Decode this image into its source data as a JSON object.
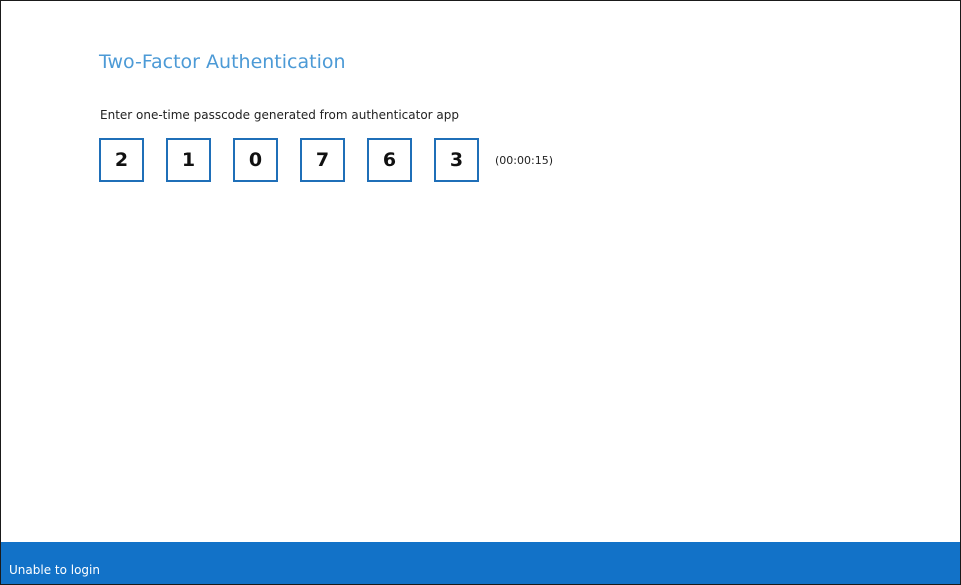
{
  "page": {
    "title": "Two-Factor Authentication",
    "instruction": "Enter one-time passcode generated from authenticator app"
  },
  "otp": {
    "digits": [
      "2",
      "1",
      "0",
      "7",
      "6",
      "3"
    ],
    "timer": "(00:00:15)"
  },
  "footer": {
    "link_label": "Unable to login"
  },
  "colors": {
    "title": "#4c9ad6",
    "box_border": "#1f6fb8",
    "footer_bg": "#1272c8"
  }
}
